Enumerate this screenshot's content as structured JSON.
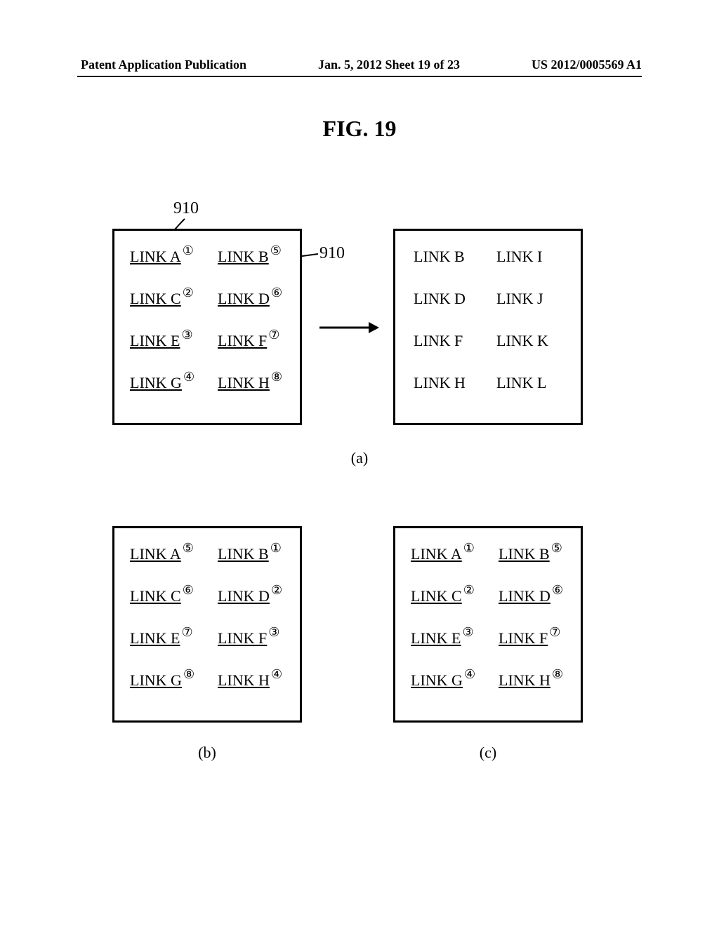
{
  "header": {
    "left": "Patent Application Publication",
    "center": "Jan. 5, 2012   Sheet 19 of 23",
    "right": "US 2012/0005569 A1"
  },
  "figure_title": "FIG.  19",
  "callout_ref": "910",
  "panels": {
    "a_left": [
      {
        "label": "LINK A",
        "badge": "①"
      },
      {
        "label": "LINK B",
        "badge": "⑤"
      },
      {
        "label": "LINK C",
        "badge": "②"
      },
      {
        "label": "LINK D",
        "badge": "⑥"
      },
      {
        "label": "LINK E",
        "badge": "③"
      },
      {
        "label": "LINK F",
        "badge": "⑦"
      },
      {
        "label": "LINK G",
        "badge": "④"
      },
      {
        "label": "LINK H",
        "badge": "⑧"
      }
    ],
    "a_right": [
      {
        "label": "LINK B"
      },
      {
        "label": "LINK I"
      },
      {
        "label": "LINK D"
      },
      {
        "label": "LINK J"
      },
      {
        "label": "LINK F"
      },
      {
        "label": "LINK K"
      },
      {
        "label": "LINK H"
      },
      {
        "label": "LINK L"
      }
    ],
    "b": [
      {
        "label": "LINK A",
        "badge": "⑤"
      },
      {
        "label": "LINK B",
        "badge": "①"
      },
      {
        "label": "LINK C",
        "badge": "⑥"
      },
      {
        "label": "LINK D",
        "badge": "②"
      },
      {
        "label": "LINK E",
        "badge": "⑦"
      },
      {
        "label": "LINK F",
        "badge": "③"
      },
      {
        "label": "LINK G",
        "badge": "⑧"
      },
      {
        "label": "LINK H",
        "badge": "④"
      }
    ],
    "c": [
      {
        "label": "LINK A",
        "badge": "①"
      },
      {
        "label": "LINK B",
        "badge": "⑤"
      },
      {
        "label": "LINK C",
        "badge": "②"
      },
      {
        "label": "LINK D",
        "badge": "⑥"
      },
      {
        "label": "LINK E",
        "badge": "③"
      },
      {
        "label": "LINK F",
        "badge": "⑦"
      },
      {
        "label": "LINK G",
        "badge": "④"
      },
      {
        "label": "LINK H",
        "badge": "⑧"
      }
    ]
  },
  "sub_labels": {
    "a": "(a)",
    "b": "(b)",
    "c": "(c)"
  }
}
